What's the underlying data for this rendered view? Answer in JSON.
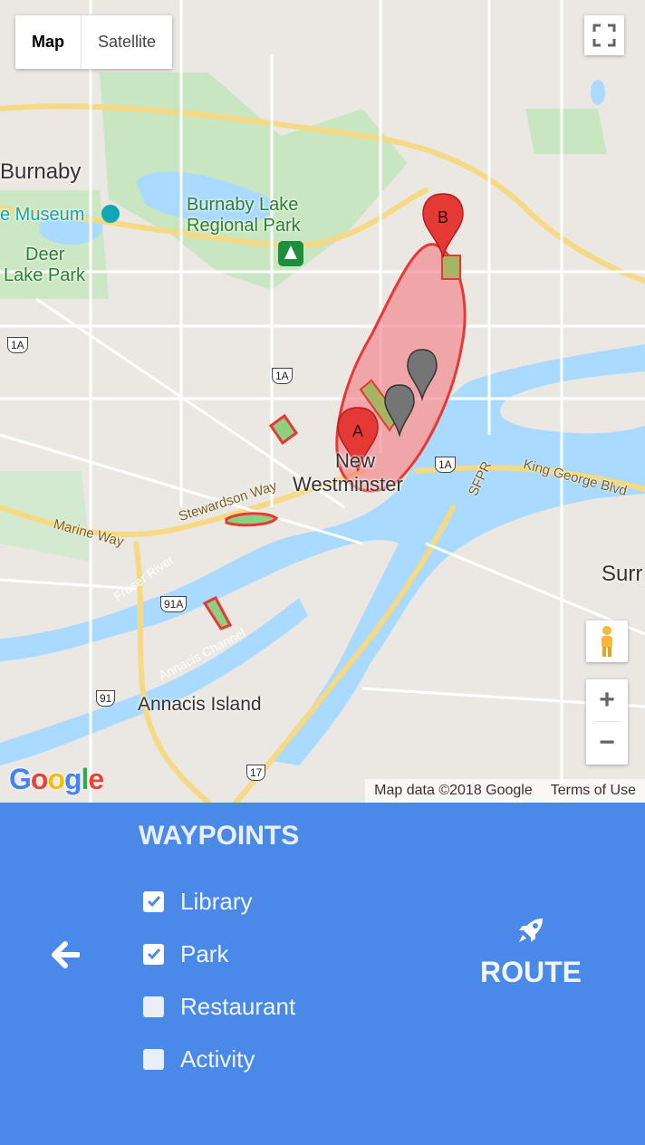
{
  "map": {
    "type_buttons": {
      "map": "Map",
      "satellite": "Satellite"
    },
    "attribution": {
      "data": "Map data ©2018 Google",
      "terms": "Terms of Use"
    },
    "logo": "Google",
    "zoom": {
      "in": "+",
      "out": "−"
    },
    "places": {
      "burnaby": "Burnaby",
      "museum": "e Museum",
      "deer_lake_1": "Deer",
      "deer_lake_2": "Lake Park",
      "burnaby_lake_1": "Burnaby Lake",
      "burnaby_lake_2": "Regional Park",
      "new_west_1": "New",
      "new_west_2": "Westminster",
      "surrey": "Surr",
      "annacis": "Annacis Island"
    },
    "roads": {
      "stewardson": "Stewardson Way",
      "marine": "Marine Way",
      "king_george": "King George Blvd",
      "sfpr": "SFPR",
      "fraser": "Fraser River",
      "annacis_channel": "Annacis Channel"
    },
    "shields": {
      "a": "1A",
      "b": "1A",
      "c": "1A",
      "d": "91A",
      "e": "91",
      "f": "17"
    },
    "markers": {
      "start": "A",
      "end": "B"
    }
  },
  "panel": {
    "title": "WAYPOINTS",
    "items": [
      {
        "label": "Library",
        "checked": true
      },
      {
        "label": "Park",
        "checked": true
      },
      {
        "label": "Restaurant",
        "checked": false
      },
      {
        "label": "Activity",
        "checked": false
      }
    ],
    "route_label": "ROUTE"
  },
  "colors": {
    "panel_bg": "#4a89e8",
    "marker_red": "#e53935",
    "water": "#aadaff"
  }
}
